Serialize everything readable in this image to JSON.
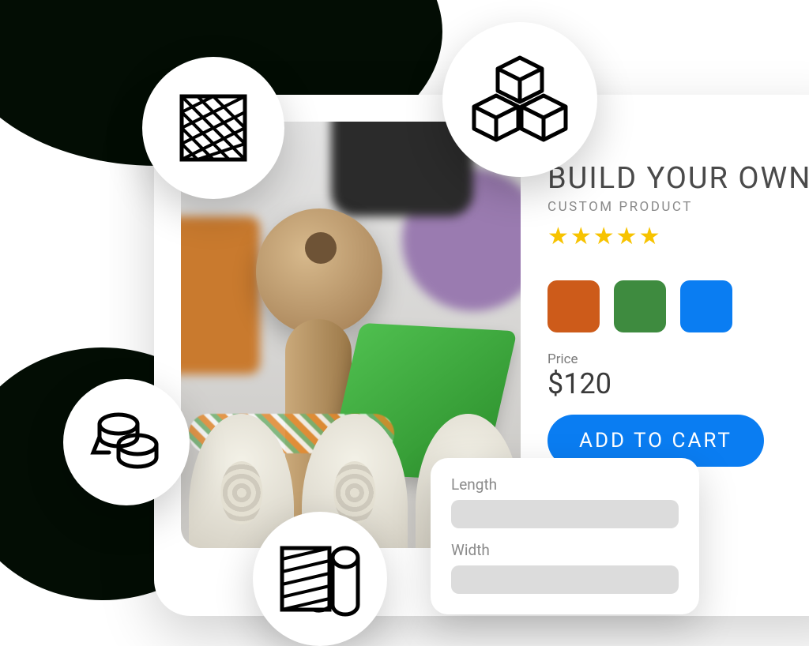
{
  "product": {
    "title": "BUILD YOUR OWN",
    "subtitle": "CUSTOM PRODUCT",
    "rating": 5,
    "swatches": [
      "#cd5b1a",
      "#3e8b3f",
      "#0a7df2"
    ],
    "price_label": "Price",
    "price_value": "$120",
    "add_to_cart_label": "ADD TO CART"
  },
  "dimensions": {
    "length_label": "Length",
    "width_label": "Width"
  },
  "icons": {
    "tile": "tile-pattern-icon",
    "boxes": "boxes-icon",
    "rolls": "fabric-rolls-icon",
    "fabric": "fabric-roll-icon"
  }
}
